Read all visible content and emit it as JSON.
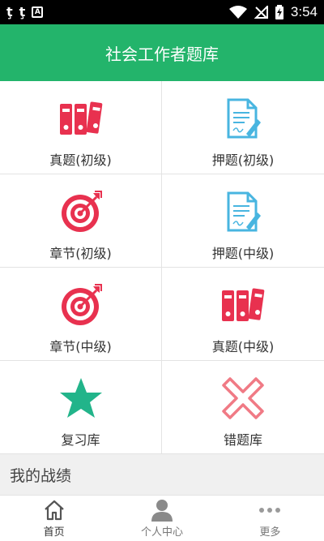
{
  "status_bar": {
    "notification_glyphs": [
      "ţ",
      "ţ"
    ],
    "a_icon_text": "A",
    "time": "3:54"
  },
  "header": {
    "title": "社会工作者题库"
  },
  "grid": {
    "items": [
      {
        "label": "真题(初级)",
        "icon": "binders-icon"
      },
      {
        "label": "押题(初级)",
        "icon": "document-pen-icon"
      },
      {
        "label": "章节(初级)",
        "icon": "target-icon"
      },
      {
        "label": "押题(中级)",
        "icon": "document-pen-icon"
      },
      {
        "label": "章节(中级)",
        "icon": "target-icon"
      },
      {
        "label": "真题(中级)",
        "icon": "binders-icon"
      },
      {
        "label": "复习库",
        "icon": "star-icon"
      },
      {
        "label": "错题库",
        "icon": "x-icon"
      }
    ]
  },
  "section": {
    "title": "我的战绩"
  },
  "tabbar": {
    "items": [
      {
        "label": "首页",
        "icon": "home-icon",
        "active": true
      },
      {
        "label": "个人中心",
        "icon": "person-icon",
        "active": false
      },
      {
        "label": "更多",
        "icon": "more-icon",
        "active": false
      }
    ]
  },
  "colors": {
    "header_bg": "#23b46b",
    "binder_red": "#e8314f",
    "doc_blue": "#48b5e0",
    "target_red": "#e8314f",
    "star_green": "#22b48a",
    "x_pink": "#f07a85"
  }
}
